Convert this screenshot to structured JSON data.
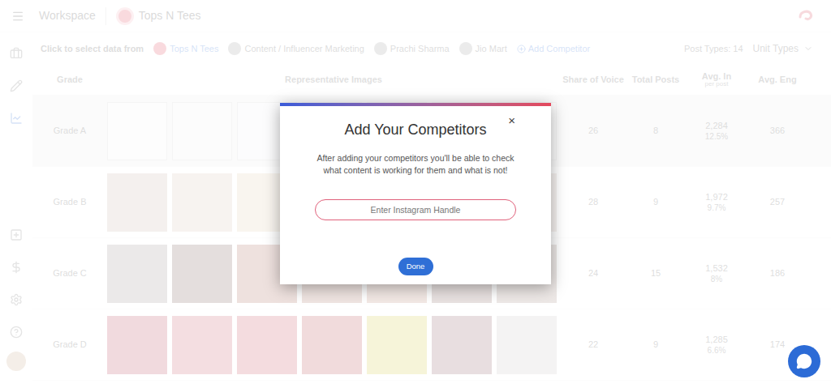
{
  "topbar": {
    "workspace": "Workspace",
    "brand": "Tops N Tees"
  },
  "filters": {
    "label": "Click to select data from",
    "chips": [
      {
        "label": "Tops N Tees",
        "selected": true
      },
      {
        "label": "Content / Influencer Marketing",
        "selected": false
      },
      {
        "label": "Prachi Sharma",
        "selected": false
      },
      {
        "label": "Jio Mart",
        "selected": false
      }
    ],
    "add": "Add Competitor",
    "total": "Post Types: 14",
    "unit_label": "Unit Types"
  },
  "table": {
    "columns": [
      {
        "label": "Grade",
        "sub": ""
      },
      {
        "label": "Representative Images",
        "sub": ""
      },
      {
        "label": "Share of Voice",
        "sub": ""
      },
      {
        "label": "Total Posts",
        "sub": ""
      },
      {
        "label": "Avg. In",
        "sub": "per post"
      },
      {
        "label": "Avg. Eng",
        "sub": ""
      }
    ],
    "rows": [
      {
        "grade": "Grade A",
        "selected": true,
        "share": "26",
        "posts": "8",
        "avg": "2,284",
        "avg_pct": "12.5%",
        "eng": "366",
        "images": [
          "#f4f4f4",
          "#f1f1f1",
          "#eef0f4",
          "#e9e2dc",
          "#f3efe9",
          "#ece6e2",
          "#f2f2f2"
        ]
      },
      {
        "grade": "Grade B",
        "selected": false,
        "share": "28",
        "posts": "9",
        "avg": "1,972",
        "avg_pct": "9.7%",
        "eng": "257",
        "images": [
          "#c9b6a8",
          "#d8c2b4",
          "#e2cbb0",
          "#cdb9a8",
          "#d9c7bb",
          "#c4b1a4",
          "#d3c0b2"
        ]
      },
      {
        "grade": "Grade C",
        "selected": false,
        "share": "24",
        "posts": "15",
        "avg": "1,532",
        "avg_pct": "8%",
        "eng": "186",
        "images": [
          "#9a9090",
          "#7a5a55",
          "#a86a5a",
          "#b07868",
          "#c08a7a",
          "#8a6a64",
          "#a58c80"
        ]
      },
      {
        "grade": "Grade D",
        "selected": false,
        "share": "22",
        "posts": "9",
        "avg": "1,285",
        "avg_pct": "6.6%",
        "eng": "174",
        "images": [
          "#b9485a",
          "#c95a6a",
          "#c85060",
          "#b84a52",
          "#d4c640",
          "#8a5a66",
          "#c8c2c4"
        ]
      }
    ]
  },
  "modal": {
    "title": "Add Your Competitors",
    "close": "×",
    "description": "After adding your competitors you'll be able to check what content is working for them and what is not!",
    "placeholder": "Enter Instagram Handle",
    "button": "Done"
  }
}
